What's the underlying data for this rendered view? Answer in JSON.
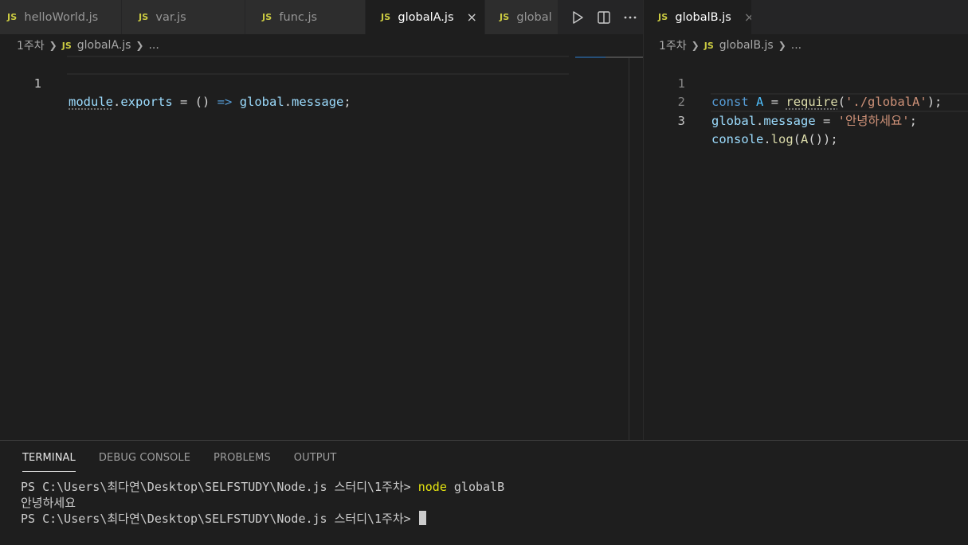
{
  "left_group": {
    "tabs": [
      {
        "label": "helloWorld.js",
        "badge": "JS",
        "active": false
      },
      {
        "label": "var.js",
        "badge": "JS",
        "active": false
      },
      {
        "label": "func.js",
        "badge": "JS",
        "active": false
      },
      {
        "label": "globalA.js",
        "badge": "JS",
        "active": true,
        "close": "×"
      },
      {
        "label": "global",
        "badge": "JS",
        "active": false
      }
    ],
    "actions": [
      "run-icon",
      "split-editor-icon",
      "more-actions-icon"
    ],
    "breadcrumb": {
      "folder": "1주차",
      "badge": "JS",
      "file": "globalA.js",
      "more": "..."
    },
    "lines": [
      {
        "number": "1",
        "tokens": [
          "module",
          ".",
          "exports",
          " = () ",
          "=>",
          " ",
          "global",
          ".",
          "message",
          ";"
        ]
      }
    ]
  },
  "right_group": {
    "tab": {
      "label": "globalB.js",
      "badge": "JS",
      "close": "×"
    },
    "breadcrumb": {
      "folder": "1주차",
      "badge": "JS",
      "file": "globalB.js",
      "more": "..."
    },
    "lines": [
      {
        "number": "1",
        "tokens": [
          "const",
          " ",
          "A",
          " = ",
          "require",
          "(",
          "'./globalA'",
          ");"
        ]
      },
      {
        "number": "2",
        "tokens": [
          "global",
          ".",
          "message",
          " = ",
          "'안녕하세요'",
          ";"
        ]
      },
      {
        "number": "3",
        "tokens": [
          "console",
          ".",
          "log",
          "(",
          "A",
          "());"
        ]
      }
    ]
  },
  "panel": {
    "tabs": [
      "TERMINAL",
      "DEBUG CONSOLE",
      "PROBLEMS",
      "OUTPUT"
    ],
    "active_tab": "TERMINAL",
    "terminal": {
      "line1_prompt": "PS C:\\Users\\최다연\\Desktop\\SELFSTUDY\\Node.js 스터디\\1주차> ",
      "line1_cmd": "node",
      "line1_arg": " globalB",
      "line2": "안녕하세요",
      "line3_prompt": "PS C:\\Users\\최다연\\Desktop\\SELFSTUDY\\Node.js 스터디\\1주차> "
    }
  },
  "colors": {
    "editor_bg": "#1e1e1e",
    "tab_bg": "#2d2d2d",
    "js_badge": "#cbcb41",
    "keyword": "#569cd6",
    "variable": "#9cdcfe",
    "function": "#dcdcaa",
    "string": "#ce9178",
    "terminal_command": "#e5e510"
  }
}
